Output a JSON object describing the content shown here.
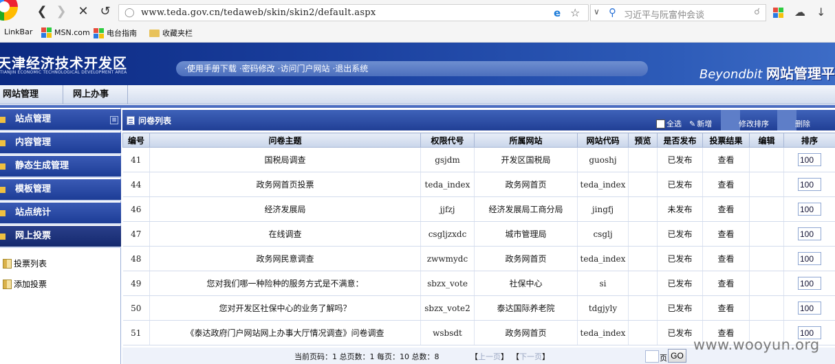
{
  "browser": {
    "url": "www.teda.gov.cn/tedaweb/skin/skin2/default.aspx",
    "search_placeholder": "习近平与阮富仲会谈",
    "bookmarks": [
      "LinkBar",
      "MSN.com",
      "电台指南",
      "收藏夹栏"
    ]
  },
  "banner": {
    "title": "天津经济技术开发区",
    "subtitle": "TIANJIN ECONOMIC TECHNOLOGICAL DEVELOPMENT AREA",
    "links": [
      "·使用手册下载",
      "·密码修改",
      "·访问门户网站",
      "·退出系统"
    ],
    "brand_en": "Beyondbit",
    "brand_cn": "网站管理平"
  },
  "menubar": [
    "网站管理",
    "网上办事"
  ],
  "sidebar": {
    "items": [
      "站点管理",
      "内容管理",
      "静态生成管理",
      "模板管理",
      "站点统计",
      "网上投票"
    ],
    "subitems": [
      "投票列表",
      "添加投票"
    ]
  },
  "content": {
    "title": "问卷列表",
    "actions": {
      "select_all": "全选",
      "add": "新增",
      "reorder": "修改排序",
      "delete": "删除"
    }
  },
  "table": {
    "headers": [
      "编号",
      "问卷主题",
      "权限代号",
      "所属网站",
      "网站代码",
      "预览",
      "是否发布",
      "投票结果",
      "编辑",
      "排序"
    ],
    "rows": [
      {
        "id": "41",
        "topic": "国税局调查",
        "perm": "gsjdm",
        "site": "开发区国税局",
        "code": "guoshj",
        "preview": "",
        "status": "已发布",
        "result": "查看",
        "edit": "",
        "sort": "100"
      },
      {
        "id": "44",
        "topic": "政务网首页投票",
        "perm": "teda_index",
        "site": "政务网首页",
        "code": "teda_index",
        "preview": "",
        "status": "已发布",
        "result": "查看",
        "edit": "",
        "sort": "100"
      },
      {
        "id": "46",
        "topic": "经济发展局",
        "perm": "jjfzj",
        "site": "经济发展局工商分局",
        "code": "jingfj",
        "preview": "",
        "status": "未发布",
        "result": "查看",
        "edit": "",
        "sort": "100"
      },
      {
        "id": "47",
        "topic": "在线调查",
        "perm": "csgljzxdc",
        "site": "城市管理局",
        "code": "csglj",
        "preview": "",
        "status": "已发布",
        "result": "查看",
        "edit": "",
        "sort": "100"
      },
      {
        "id": "48",
        "topic": "政务网民意调查",
        "perm": "zwwmydc",
        "site": "政务网首页",
        "code": "teda_index",
        "preview": "",
        "status": "已发布",
        "result": "查看",
        "edit": "",
        "sort": "100"
      },
      {
        "id": "49",
        "topic": "您对我们哪一种险种的服务方式是不满意：",
        "perm": "sbzx_vote",
        "site": "社保中心",
        "code": "si",
        "preview": "",
        "status": "已发布",
        "result": "查看",
        "edit": "",
        "sort": "100"
      },
      {
        "id": "50",
        "topic": "您对开发区社保中心的业务了解吗？",
        "perm": "sbzx_vote2",
        "site": "泰达国际养老院",
        "code": "tdgjyly",
        "preview": "",
        "status": "已发布",
        "result": "查看",
        "edit": "",
        "sort": "100"
      },
      {
        "id": "51",
        "topic": "《泰达政府门户网站网上办事大厅情况调查》问卷调查",
        "perm": "wsbsdt",
        "site": "政务网首页",
        "code": "teda_index",
        "preview": "",
        "status": "已发布",
        "result": "查看",
        "edit": "",
        "sort": "100"
      }
    ]
  },
  "pager": {
    "summary": "当前页码：1 总页数：1 每页：10 总数：8",
    "prev": "上一页",
    "next": "下一页",
    "page_label": "页",
    "go": "GO"
  },
  "watermark": "www.wooyun.org"
}
